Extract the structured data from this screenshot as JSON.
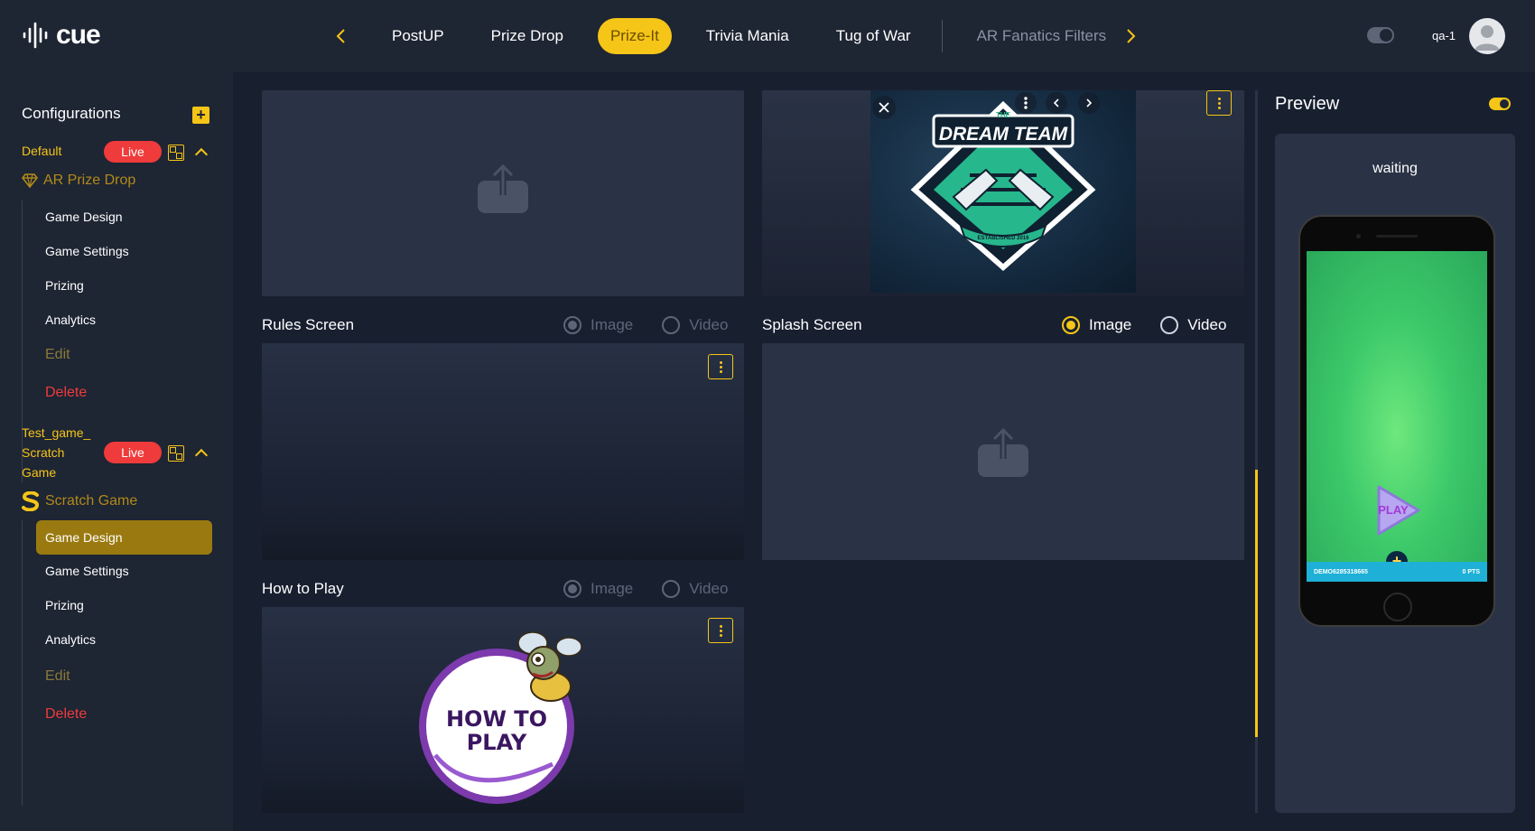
{
  "app": {
    "logo_text": "cue"
  },
  "nav": {
    "tabs": [
      {
        "label": "PostUP",
        "state": "normal"
      },
      {
        "label": "Prize Drop",
        "state": "normal"
      },
      {
        "label": "Prize-It",
        "state": "active"
      },
      {
        "label": "Trivia Mania",
        "state": "normal"
      },
      {
        "label": "Tug of War",
        "state": "normal"
      },
      {
        "label": "AR Fanatics Filters",
        "state": "dim"
      }
    ]
  },
  "header": {
    "user_name": "qa-1"
  },
  "sidebar": {
    "title": "Configurations",
    "add_label": "+",
    "configs": [
      {
        "name": "Default",
        "badge": "Live",
        "game_type": "AR Prize Drop",
        "items": [
          "Game Design",
          "Game Settings",
          "Prizing",
          "Analytics"
        ],
        "edit": "Edit",
        "delete": "Delete"
      },
      {
        "name_lines": [
          "Test_game_",
          "Scratch",
          "Game"
        ],
        "badge": "Live",
        "game_type": "Scratch Game",
        "items": [
          "Game Design",
          "Game Settings",
          "Prizing",
          "Analytics"
        ],
        "active_item": "Game Design",
        "edit": "Edit",
        "delete": "Delete"
      }
    ]
  },
  "main": {
    "rules": {
      "label": "Rules Screen",
      "opt_image": "Image",
      "opt_video": "Video"
    },
    "splash": {
      "label": "Splash Screen",
      "opt_image": "Image",
      "opt_video": "Video"
    },
    "howto": {
      "label": "How to Play",
      "opt_image": "Image",
      "opt_video": "Video"
    },
    "dream_team_logo": {
      "small_text": "THE",
      "big_text": "DREAM TEAM",
      "ribbon": "ESTABLISHED 2016"
    },
    "howto_art": {
      "line1": "HOW TO",
      "line2": "PLAY"
    }
  },
  "preview": {
    "title": "Preview",
    "status": "waiting",
    "play_label": "PLAY",
    "bar_left": "DEMO6285318665",
    "bar_right": "0 PTS"
  },
  "colors": {
    "accent": "#f5c518",
    "live": "#ef3b3b",
    "bg": "#1e2533",
    "card": "#2a3345"
  }
}
